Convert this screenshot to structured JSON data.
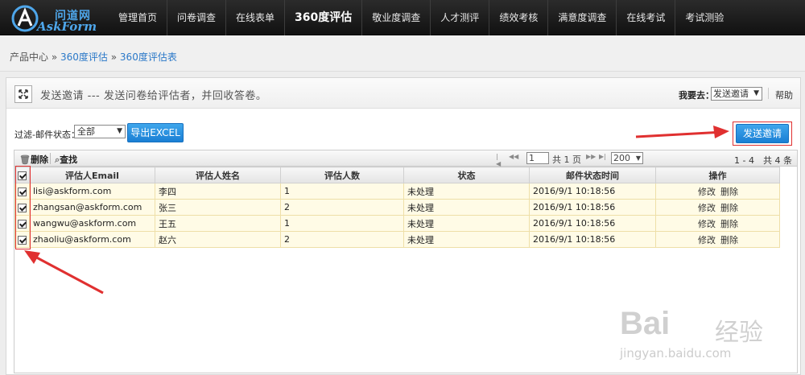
{
  "brand": {
    "cn": "问道网",
    "en": "AskForm"
  },
  "nav": [
    {
      "label": "管理首页",
      "active": false
    },
    {
      "label": "问卷调查",
      "active": false
    },
    {
      "label": "在线表单",
      "active": false
    },
    {
      "label": "360度评估",
      "active": true
    },
    {
      "label": "敬业度调查",
      "active": false
    },
    {
      "label": "人才测评",
      "active": false
    },
    {
      "label": "绩效考核",
      "active": false
    },
    {
      "label": "满意度调查",
      "active": false
    },
    {
      "label": "在线考试",
      "active": false
    },
    {
      "label": "考试测验",
      "active": false
    }
  ],
  "breadcrumb": {
    "root": "产品中心",
    "sep": "»",
    "level1": "360度评估",
    "level2": "360度评估表"
  },
  "panel": {
    "title": "发送邀请 --- 发送问卷给评估者，并回收答卷。",
    "goto_label": "我要去：",
    "goto_value": "发送邀请",
    "help": "帮助"
  },
  "filter": {
    "label": "过滤-邮件状态：",
    "value": "全部",
    "export_label": "导出EXCEL",
    "send_label": "发送邀请"
  },
  "toolbar": {
    "delete_label": "删除",
    "find_label": "查找"
  },
  "pager": {
    "page": "1",
    "total": "共 1 页",
    "page_size": "200",
    "range": "1 - 4　共 4 条"
  },
  "table": {
    "columns": [
      "评估人Email",
      "评估人姓名",
      "评估人数",
      "状态",
      "邮件状态时间",
      "操作"
    ],
    "rows": [
      {
        "email": "lisi@askform.com",
        "name": "李四",
        "count": "1",
        "status": "未处理",
        "time": "2016/9/1 10:18:56",
        "checked": true
      },
      {
        "email": "zhangsan@askform.com",
        "name": "张三",
        "count": "2",
        "status": "未处理",
        "time": "2016/9/1 10:18:56",
        "checked": true
      },
      {
        "email": "wangwu@askform.com",
        "name": "王五",
        "count": "1",
        "status": "未处理",
        "time": "2016/9/1 10:18:56",
        "checked": true
      },
      {
        "email": "zhaoliu@askform.com",
        "name": "赵六",
        "count": "2",
        "status": "未处理",
        "time": "2016/9/1 10:18:56",
        "checked": true
      }
    ],
    "edit_label": "修改",
    "delete_label": "删除"
  },
  "watermark": {
    "logo": "Bai",
    "logo_tail": "经验",
    "url": "jingyan.baidu.com"
  },
  "colors": {
    "accent": "#1a7fd4",
    "annotation": "#e03030",
    "row_bg": "#fffbe6"
  }
}
